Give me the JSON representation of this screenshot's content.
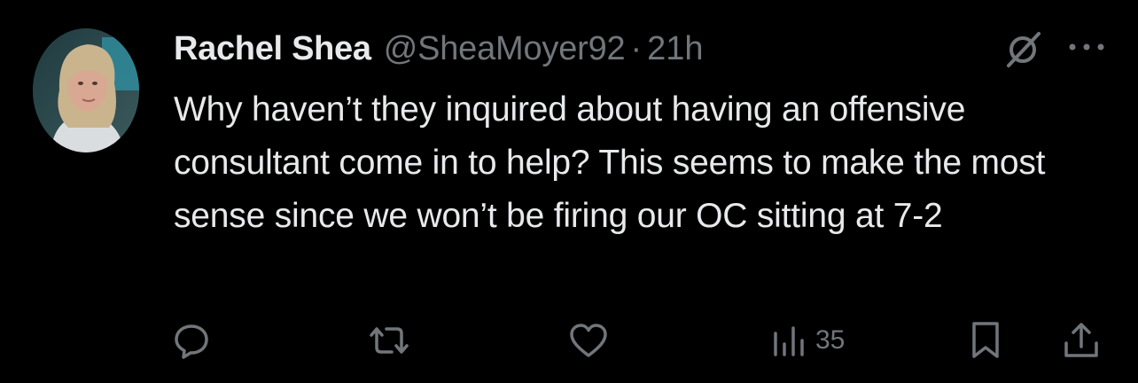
{
  "tweet": {
    "display_name": "Rachel Shea",
    "handle": "@SheaMoyer92",
    "separator": "·",
    "time": "21h",
    "text": "Why haven’t they inquired about having an offensive consultant come in to help? This seems to make the most sense since we won’t be firing our OC sitting at 7-2"
  },
  "icons": {
    "grok": "grok-icon",
    "more": "more-horizontal-icon",
    "reply": "reply-icon",
    "retweet": "retweet-icon",
    "like": "like-icon",
    "views": "views-icon",
    "bookmark": "bookmark-icon",
    "share": "share-icon"
  },
  "actions": {
    "views_count": "35"
  },
  "colors": {
    "background": "#000000",
    "primary_text": "#e7e9ea",
    "secondary_text": "#71767b"
  }
}
